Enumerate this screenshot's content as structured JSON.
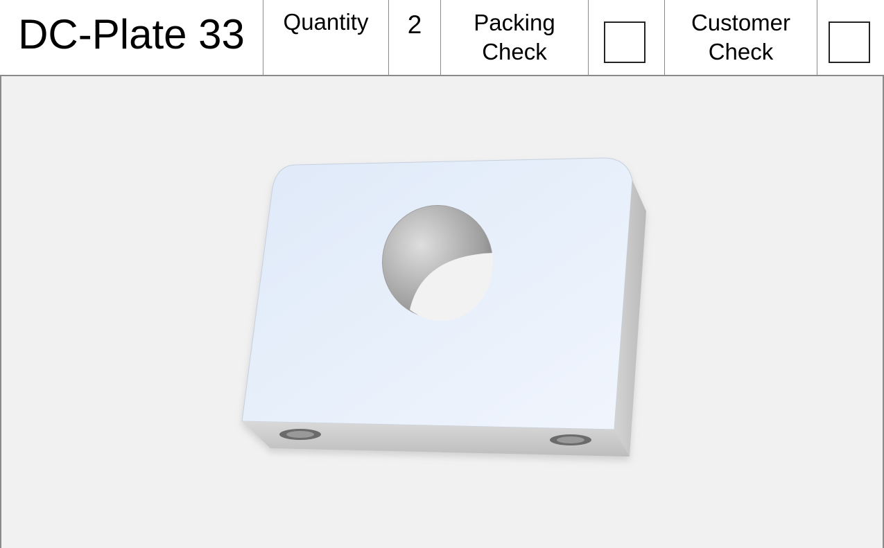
{
  "sheet": {
    "part_name": "DC-Plate 33",
    "quantity_label": "Quantity",
    "quantity_value": "2",
    "packing_check_line1": "Packing",
    "packing_check_line2": "Check",
    "customer_check_line1": "Customer",
    "customer_check_line2": "Check"
  },
  "checks": {
    "packing_checked": false,
    "customer_checked": false
  },
  "colors": {
    "header_border": "#8a8a8a",
    "background": "#f1f1f1",
    "part_face": "#e6eef9",
    "part_side": "#c8c8c8"
  },
  "image": {
    "subject": "rectangular plate with one large through hole and two small bottom holes"
  }
}
